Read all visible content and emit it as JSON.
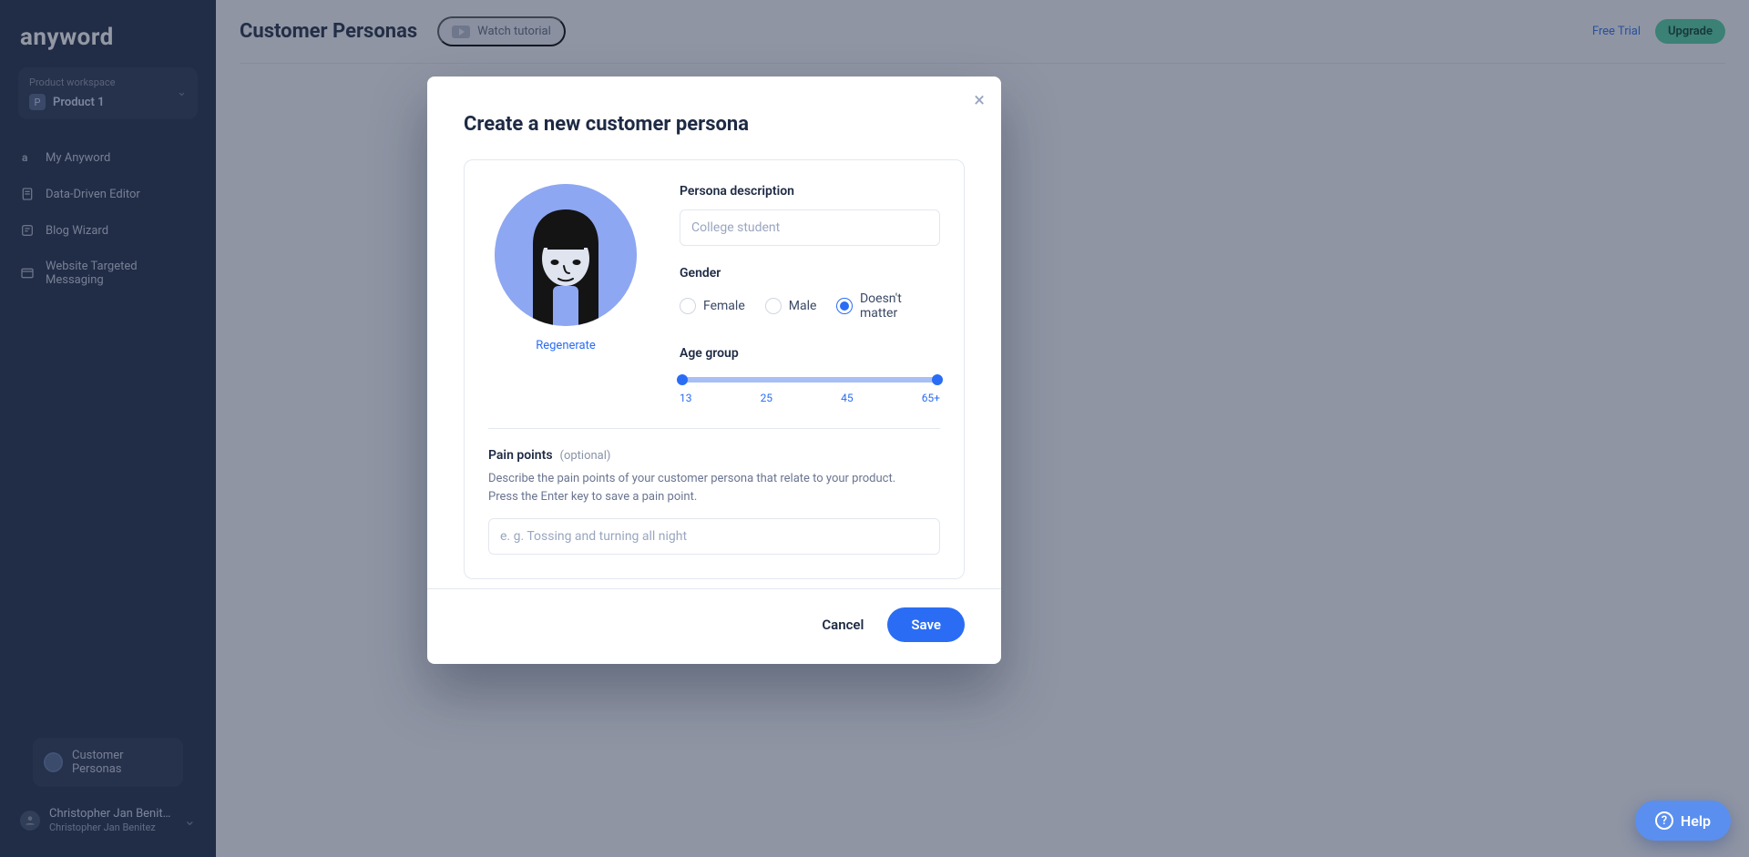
{
  "brand": "anyword",
  "workspace": {
    "label": "Product workspace",
    "badge": "P",
    "name": "Product 1"
  },
  "nav": [
    {
      "label": "My Anyword"
    },
    {
      "label": "Data-Driven Editor"
    },
    {
      "label": "Blog Wizard"
    },
    {
      "label": "Website Targeted Messaging"
    }
  ],
  "nav_active": "Customer Personas",
  "user": {
    "name": "Christopher Jan Benit…",
    "sub": "Christopher Jan Benitez"
  },
  "page": {
    "title": "Customer Personas",
    "watch": "Watch tutorial",
    "free_trial": "Free Trial",
    "upgrade": "Upgrade"
  },
  "modal": {
    "title": "Create a new customer persona",
    "regenerate": "Regenerate",
    "description_label": "Persona description",
    "description_placeholder": "College student",
    "description_value": "",
    "gender_label": "Gender",
    "gender_options": {
      "female": "Female",
      "male": "Male",
      "nm": "Doesn't matter"
    },
    "gender_selected": "nm",
    "age_label": "Age group",
    "age_ticks": [
      "13",
      "25",
      "45",
      "65+"
    ],
    "age_range": {
      "min": 13,
      "max": 65,
      "selected_min": 13,
      "selected_max": 65
    },
    "pain_title": "Pain points",
    "pain_optional": "(optional)",
    "pain_desc_line1": "Describe the pain points of your customer persona that relate to your product.",
    "pain_desc_line2": "Press the Enter key to save a pain point.",
    "pain_placeholder": "e. g. Tossing and turning all night",
    "pain_value": "",
    "cancel": "Cancel",
    "save": "Save"
  },
  "help": "Help"
}
